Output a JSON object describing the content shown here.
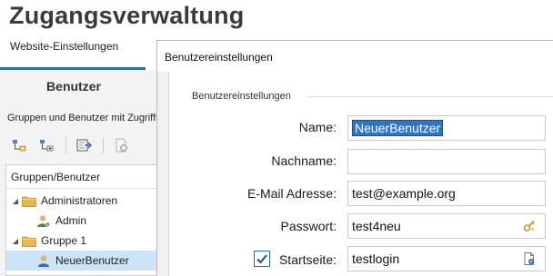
{
  "app": {
    "title": "Zugangsverwaltung",
    "subtab": "Website-Einstellungen",
    "tab": "Benutzer",
    "description": "Gruppen und Benutzer mit Zugriffsrechten"
  },
  "toolbar": {
    "icons": [
      "add-group-icon",
      "add-user-icon",
      "export-icon",
      "delete-icon"
    ]
  },
  "tree": {
    "header": "Gruppen/Benutzer",
    "items": [
      {
        "label": "Administratoren",
        "type": "group"
      },
      {
        "label": "Admin",
        "type": "user"
      },
      {
        "label": "Gruppe 1",
        "type": "group"
      },
      {
        "label": "NeuerBenutzer",
        "type": "user",
        "selected": true
      }
    ]
  },
  "dialog": {
    "title": "Benutzereinstellungen",
    "section": "Benutzereinstellungen",
    "fields": {
      "name": {
        "label": "Name:",
        "value": "NeuerBenutzer"
      },
      "nachname": {
        "label": "Nachname:",
        "value": ""
      },
      "email": {
        "label": "E-Mail Adresse:",
        "value": "test@example.org"
      },
      "passwort": {
        "label": "Passwort:",
        "value": "test4neu"
      },
      "startseite": {
        "label": "Startseite:",
        "value": "testlogin",
        "checked": true
      }
    }
  },
  "colors": {
    "accent": "#2b6cb3",
    "selection": "#2f74c6",
    "tree_selection": "#cde3f7",
    "folder": "#e8b84a"
  }
}
